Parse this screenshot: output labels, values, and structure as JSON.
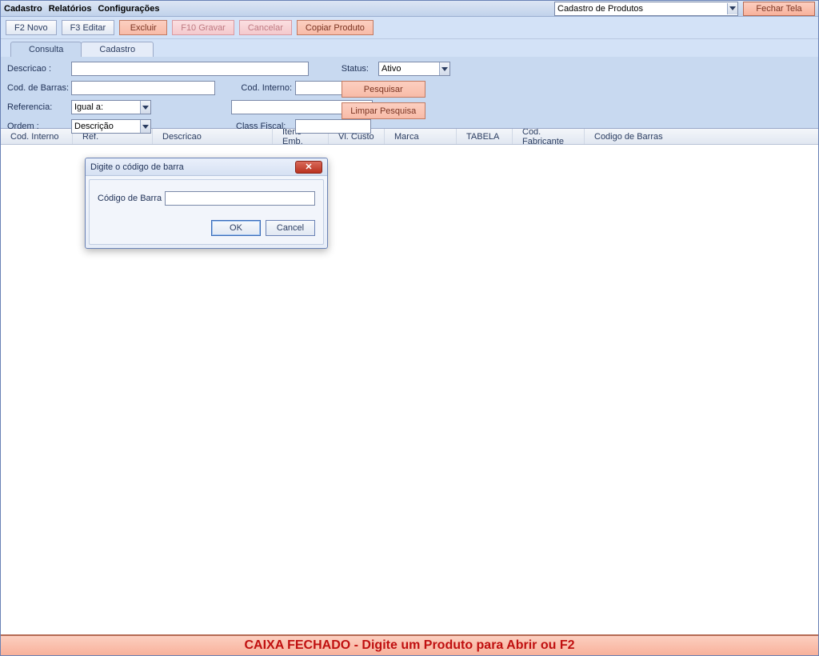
{
  "menu": {
    "cadastro": "Cadastro",
    "relatorios": "Relatórios",
    "configuracoes": "Configurações"
  },
  "header": {
    "screen_select": "Cadastro de Produtos",
    "fechar": "Fechar Tela"
  },
  "toolbar": {
    "novo": "F2 Novo",
    "editar": "F3 Editar",
    "excluir": "Excluir",
    "gravar": "F10 Gravar",
    "cancelar": "Cancelar",
    "copiar": "Copiar Produto"
  },
  "tabs": {
    "consulta": "Consulta",
    "cadastro": "Cadastro"
  },
  "filters": {
    "descricao_lbl": "Descricao :",
    "codbarras_lbl": "Cod. de Barras:",
    "codinterno_lbl": "Cod. Interno:",
    "referencia_lbl": "Referencia:",
    "referencia_sel": "Igual a:",
    "ordem_lbl": "Ordem :",
    "ordem_sel": "Descrição",
    "classfiscal_lbl": "Class Fiscal:",
    "status_lbl": "Status:",
    "status_sel": "Ativo",
    "pesquisar": "Pesquisar",
    "limpar": "Limpar Pesquisa"
  },
  "grid": {
    "cols": {
      "codinterno": "Cod. Interno",
      "ref": "Ref.",
      "descricao": "Descricao",
      "itensemb": "Itens Emb.",
      "vlcusto": "Vl. Custo",
      "marca": "Marca",
      "tabela": "TABELA",
      "codfabricante": "Cod. Fabricante",
      "codigobarras": "Codigo de Barras"
    }
  },
  "dialog": {
    "title": "Digite o código de barra",
    "label": "Código de Barra",
    "value": "",
    "ok": "OK",
    "cancel": "Cancel"
  },
  "footer": {
    "text": "CAIXA FECHADO - Digite um Produto para Abrir ou F2"
  }
}
